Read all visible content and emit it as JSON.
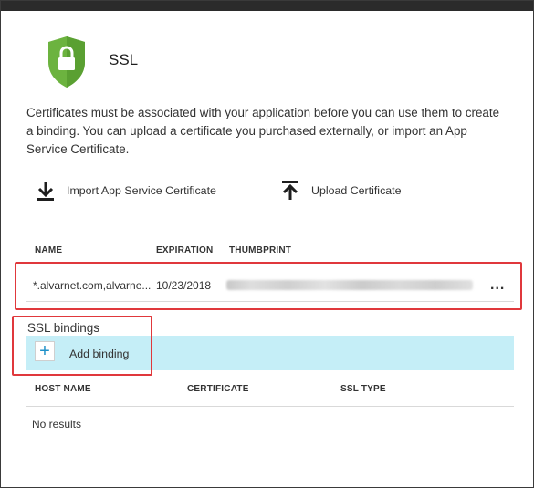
{
  "header": {
    "title": "SSL"
  },
  "description": "Certificates must be associated with your application before you can use them to create a binding. You can upload a certificate you purchased externally, or import an App Service Certificate.",
  "toolbar": {
    "import_label": "Import App Service Certificate",
    "upload_label": "Upload Certificate"
  },
  "certificates": {
    "columns": [
      "NAME",
      "EXPIRATION",
      "THUMBPRINT"
    ],
    "rows": [
      {
        "name": "*.alvarnet.com,alvarne...",
        "expiration": "10/23/2018",
        "thumbprint": "",
        "more": "..."
      }
    ]
  },
  "bindings": {
    "section_title": "SSL bindings",
    "add_label": "Add binding",
    "columns": [
      "HOST NAME",
      "CERTIFICATE",
      "SSL TYPE"
    ],
    "empty_text": "No results"
  },
  "colors": {
    "accent_green": "#6cb33f",
    "highlight_blue": "#c5eef7",
    "annotation_red": "#e0383c"
  },
  "icons": {
    "header": "lock-shield-icon",
    "import": "download-arrow-icon",
    "upload": "upload-arrow-icon",
    "add": "plus-icon"
  }
}
